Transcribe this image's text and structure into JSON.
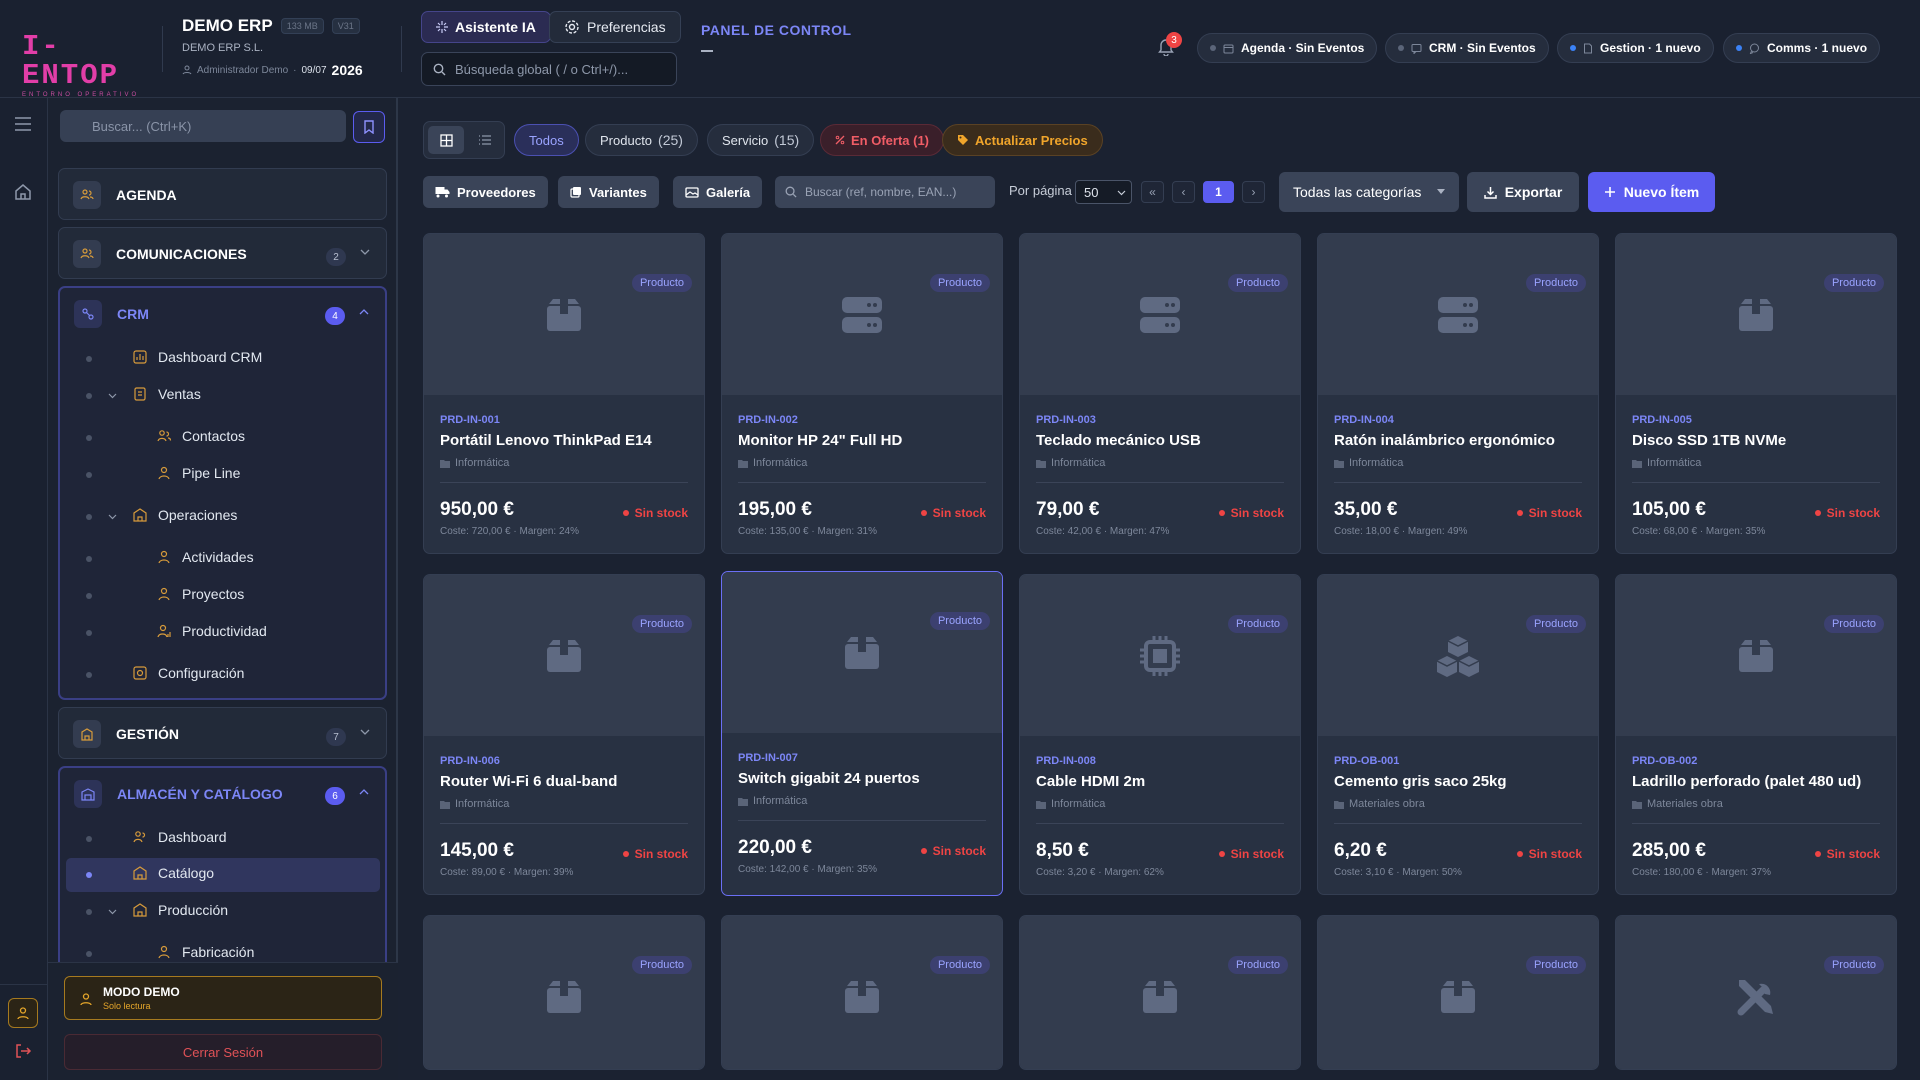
{
  "brand": {
    "logo": "I-ENTOP",
    "tagline": "ENTORNO OPERATIVO"
  },
  "company": {
    "name": "DEMO ERP",
    "size": "133 MB",
    "version": "V31",
    "legal": "DEMO ERP S.L.",
    "user": "Administrador Demo",
    "date": "09/07",
    "year": "2026"
  },
  "header": {
    "ai_label": "Asistente IA",
    "prefs_label": "Preferencias",
    "search_placeholder": "Búsqueda global ( / o Ctrl+/)...",
    "panel_title": "PANEL DE CONTROL",
    "bell_count": "3",
    "chips": [
      {
        "label": "Agenda · Sin Eventos",
        "dot": "#5b6579"
      },
      {
        "label": "CRM · Sin Eventos",
        "dot": "#5b6579"
      },
      {
        "label": "Gestion · 1 nuevo",
        "dot": "#3b82f6"
      },
      {
        "label": "Comms · 1 nuevo",
        "dot": "#3b82f6"
      }
    ]
  },
  "sidebar": {
    "search_placeholder": "Buscar... (Ctrl+K)",
    "sections": {
      "agenda": "AGENDA",
      "comms": "COMUNICACIONES",
      "comms_badge": "2",
      "crm": "CRM",
      "crm_badge": "4",
      "gestion": "GESTIÓN",
      "gestion_badge": "7",
      "almacen": "ALMACÉN Y CATÁLOGO",
      "almacen_badge": "6"
    },
    "crm_items": [
      "Dashboard CRM",
      "Ventas",
      "Contactos",
      "Pipe Line",
      "Operaciones",
      "Actividades",
      "Proyectos",
      "Productividad",
      "Configuración"
    ],
    "almacen_items": [
      "Dashboard",
      "Catálogo",
      "Producción",
      "Fabricación"
    ],
    "demo_title": "MODO DEMO",
    "demo_sub": "Solo lectura",
    "logout": "Cerrar Sesión"
  },
  "toolbar": {
    "filters": {
      "todos": "Todos",
      "producto": "Producto",
      "producto_count": "(25)",
      "servicio": "Servicio",
      "servicio_count": "(15)",
      "oferta": "En Oferta (1)",
      "precios": "Actualizar Precios"
    },
    "proveedores": "Proveedores",
    "variantes": "Variantes",
    "galeria": "Galería",
    "search_placeholder": "Buscar (ref, nombre, EAN...)",
    "per_page_label": "Por página",
    "per_page": "50",
    "first": "«",
    "prev": "‹",
    "page": "1",
    "next": "›",
    "categories": "Todas las categorías",
    "export": "Exportar",
    "new_item": "Nuevo Ítem"
  },
  "products": [
    {
      "tag": "Producto",
      "ref": "PRD-IN-001",
      "name": "Portátil Lenovo ThinkPad E14",
      "category": "Informática",
      "price": "950,00 €",
      "stock": "Sin stock",
      "meta": "Coste: 720,00 € · Margen: 24%",
      "icon": "box-icon"
    },
    {
      "tag": "Producto",
      "ref": "PRD-IN-002",
      "name": "Monitor HP 24\" Full HD",
      "category": "Informática",
      "price": "195,00 €",
      "stock": "Sin stock",
      "meta": "Coste: 135,00 € · Margen: 31%",
      "icon": "server-icon"
    },
    {
      "tag": "Producto",
      "ref": "PRD-IN-003",
      "name": "Teclado mecánico USB",
      "category": "Informática",
      "price": "79,00 €",
      "stock": "Sin stock",
      "meta": "Coste: 42,00 € · Margen: 47%",
      "icon": "server-icon"
    },
    {
      "tag": "Producto",
      "ref": "PRD-IN-004",
      "name": "Ratón inalámbrico ergonómico",
      "category": "Informática",
      "price": "35,00 €",
      "stock": "Sin stock",
      "meta": "Coste: 18,00 € · Margen: 49%",
      "icon": "server-icon"
    },
    {
      "tag": "Producto",
      "ref": "PRD-IN-005",
      "name": "Disco SSD 1TB NVMe",
      "category": "Informática",
      "price": "105,00 €",
      "stock": "Sin stock",
      "meta": "Coste: 68,00 € · Margen: 35%",
      "icon": "box-icon"
    },
    {
      "tag": "Producto",
      "ref": "PRD-IN-006",
      "name": "Router Wi-Fi 6 dual-band",
      "category": "Informática",
      "price": "145,00 €",
      "stock": "Sin stock",
      "meta": "Coste: 89,00 € · Margen: 39%",
      "icon": "box-icon"
    },
    {
      "tag": "Producto",
      "ref": "PRD-IN-007",
      "name": "Switch gigabit 24 puertos",
      "category": "Informática",
      "price": "220,00 €",
      "stock": "Sin stock",
      "meta": "Coste: 142,00 € · Margen: 35%",
      "icon": "box-icon"
    },
    {
      "tag": "Producto",
      "ref": "PRD-IN-008",
      "name": "Cable HDMI 2m",
      "category": "Informática",
      "price": "8,50 €",
      "stock": "Sin stock",
      "meta": "Coste: 3,20 € · Margen: 62%",
      "icon": "chip-icon"
    },
    {
      "tag": "Producto",
      "ref": "PRD-OB-001",
      "name": "Cemento gris saco 25kg",
      "category": "Materiales obra",
      "price": "6,20 €",
      "stock": "Sin stock",
      "meta": "Coste: 3,10 € · Margen: 50%",
      "icon": "boxes-icon"
    },
    {
      "tag": "Producto",
      "ref": "PRD-OB-002",
      "name": "Ladrillo perforado (palet 480 ud)",
      "category": "Materiales obra",
      "price": "285,00 €",
      "stock": "Sin stock",
      "meta": "Coste: 180,00 € · Margen: 37%",
      "icon": "box-icon"
    },
    {
      "tag": "Producto",
      "icon": "box-icon"
    },
    {
      "tag": "Producto",
      "icon": "box-icon"
    },
    {
      "tag": "Producto",
      "icon": "box-icon"
    },
    {
      "tag": "Producto",
      "icon": "box-icon"
    },
    {
      "tag": "Producto",
      "icon": "tools-icon"
    }
  ],
  "colors": {
    "accent": "#5b5cf0",
    "danger": "#ef4444",
    "warning": "#f0a52b",
    "bg": "#1b2231"
  }
}
